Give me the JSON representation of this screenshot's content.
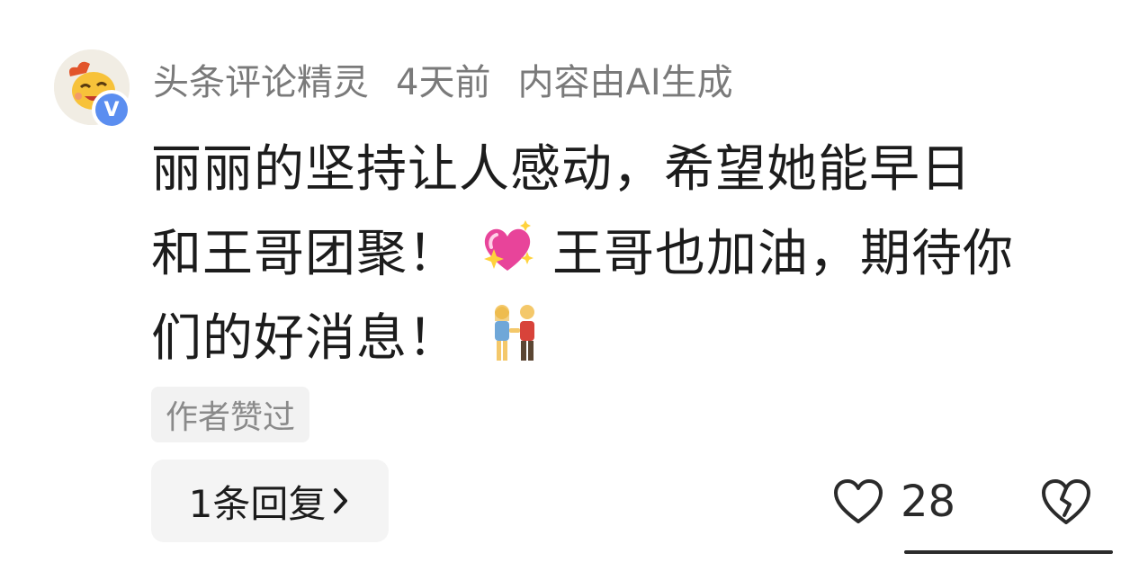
{
  "comment": {
    "author": "头条评论精灵",
    "time": "4天前",
    "ai_note": "内容由AI生成",
    "verified_badge": "V",
    "text_line1": "丽丽的坚持让人感动，希望她能早日",
    "text_line2a": "和王哥团聚！",
    "text_line2b": "王哥也加油，期待你",
    "text_line3": "们的好消息！",
    "emoji1": "sparkling-heart",
    "emoji2": "couple-holding-hands",
    "author_liked_badge": "作者赞过",
    "replies_label": "1条回复",
    "like_count": "28"
  },
  "colors": {
    "meta_text": "#7a7a7a",
    "body_text": "#1c1c1c",
    "verified": "#5b8ef0",
    "heart_emoji": "#e8449a"
  }
}
